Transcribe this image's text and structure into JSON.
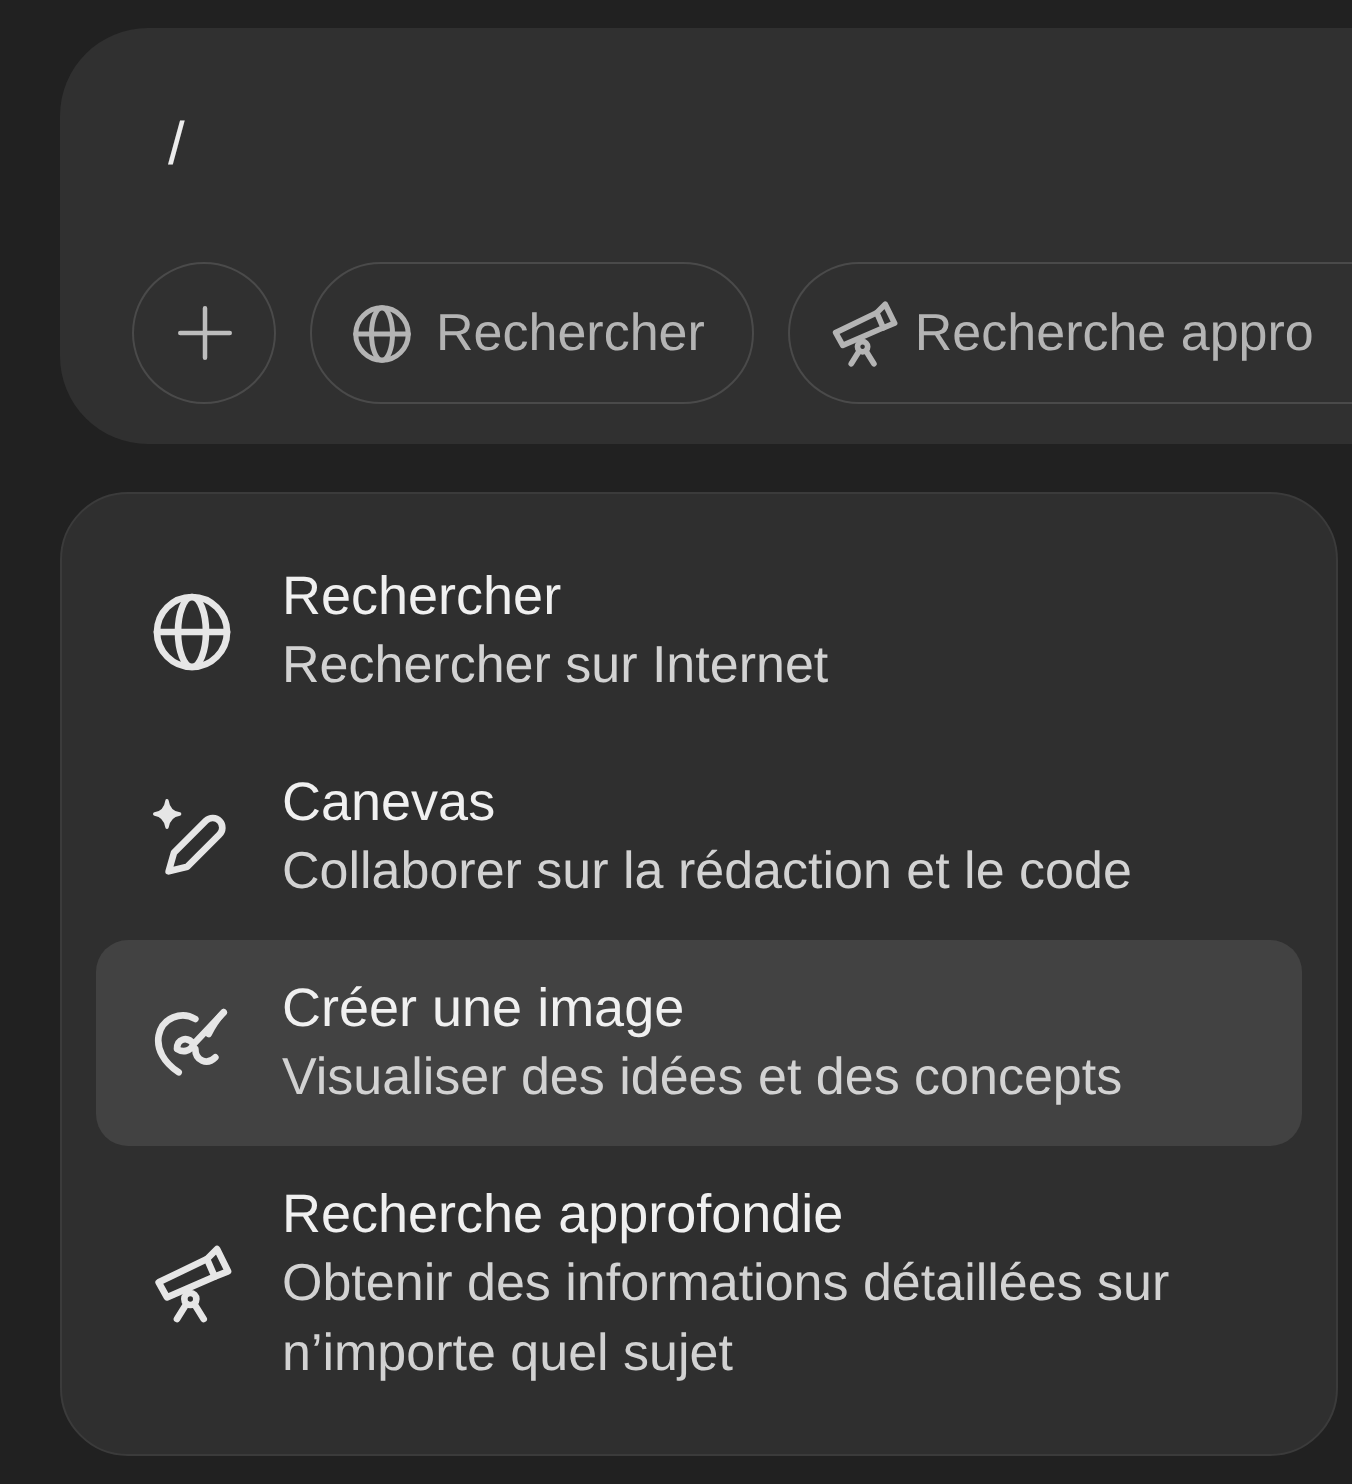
{
  "composer": {
    "value": "/",
    "tools": [
      {
        "label": "Rechercher"
      },
      {
        "label": "Recherche appro"
      }
    ]
  },
  "menu": {
    "items": [
      {
        "title": "Rechercher",
        "description": "Rechercher sur Internet",
        "selected": false
      },
      {
        "title": "Canevas",
        "description": "Collaborer sur la rédaction et le code",
        "selected": false
      },
      {
        "title": "Créer une image",
        "description": "Visualiser des idées et des concepts",
        "selected": true
      },
      {
        "title": "Recherche approfondie",
        "description": "Obtenir des informations détaillées sur n’importe quel sujet",
        "selected": false
      }
    ]
  }
}
